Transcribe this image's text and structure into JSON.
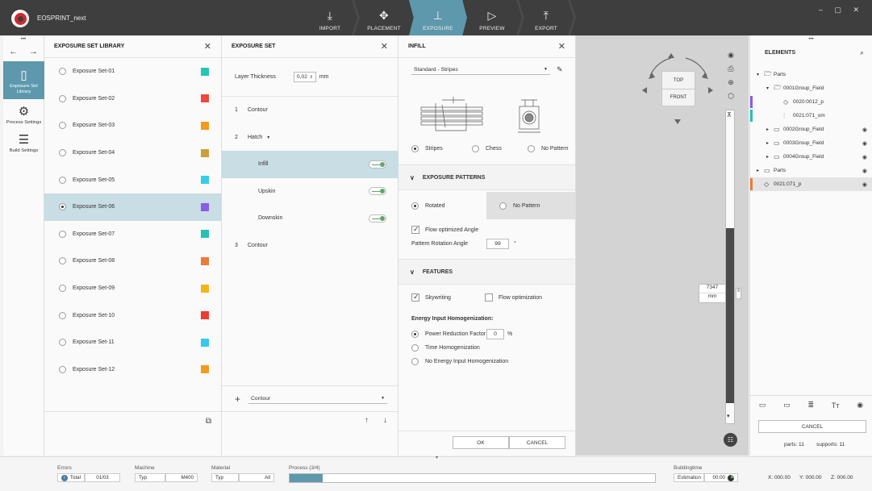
{
  "app": {
    "title": "EOSPRINT_next",
    "window_controls": "– ▢ ✕"
  },
  "nav_tabs": [
    {
      "label": "IMPORT",
      "icon": "download-icon"
    },
    {
      "label": "PLACEMENT",
      "icon": "move-icon"
    },
    {
      "label": "EXPOSURE",
      "icon": "exposure-icon",
      "active": true
    },
    {
      "label": "PREVIEW",
      "icon": "play-icon"
    },
    {
      "label": "EXPORT",
      "icon": "upload-icon"
    }
  ],
  "rail": {
    "dots": "•••",
    "items": [
      {
        "label": "Exposure Set Library",
        "active": true
      },
      {
        "label": "Process Settings"
      },
      {
        "label": "Build Settings"
      }
    ]
  },
  "library": {
    "title": "EXPOSURE SET LIBRARY",
    "sets": [
      {
        "label": "Exposure Set-01",
        "color": "#26c4b4"
      },
      {
        "label": "Exposure Set-02",
        "color": "#f0473e"
      },
      {
        "label": "Exposure Set-03",
        "color": "#f59a1f"
      },
      {
        "label": "Exposure Set-04",
        "color": "#c9a03a"
      },
      {
        "label": "Exposure Set-05",
        "color": "#35cde8"
      },
      {
        "label": "Exposure Set-06",
        "color": "#8a5ce6",
        "selected": true
      },
      {
        "label": "Exposure Set-07",
        "color": "#23c2b5"
      },
      {
        "label": "Exposure Set-08",
        "color": "#ec7b3a"
      },
      {
        "label": "Exposure Set-09",
        "color": "#f2b51a"
      },
      {
        "label": "Exposure Set-10",
        "color": "#ee3b32"
      },
      {
        "label": "Exposure Set-11",
        "color": "#3bc6ee"
      },
      {
        "label": "Exposure Set-12",
        "color": "#f6991f"
      }
    ]
  },
  "exposure_set": {
    "title": "EXPOSURE SET",
    "layer_thickness_label": "Layer Thickness",
    "layer_thickness_value": "0,02",
    "layer_thickness_unit": "mm",
    "rows": [
      {
        "num": "1",
        "label": "Contour"
      },
      {
        "num": "2",
        "label": "Hatch",
        "dropdown": "▾"
      },
      {
        "num": "",
        "label": "Infill",
        "toggle": true,
        "selected": true
      },
      {
        "num": "",
        "label": "Upskin",
        "toggle": true
      },
      {
        "num": "",
        "label": "Downskin",
        "toggle": true
      },
      {
        "num": "3",
        "label": "Contour"
      }
    ],
    "add_select_value": "Contour"
  },
  "infill": {
    "title": "INFILL",
    "strategy": "Standard - Stripes",
    "pattern_options": [
      "Stripes",
      "Chess",
      "No Pattern"
    ],
    "pattern_selected": "Stripes",
    "exposure_patterns": {
      "title": "EXPOSURE PATTERNS",
      "options": [
        "Rotated",
        "No Pattern"
      ],
      "selected": "Rotated",
      "flow_optimized_label": "Flow optimized Angle",
      "rotation_label": "Pattern Rotation Angle",
      "rotation_value": "99",
      "rotation_unit": "°"
    },
    "features": {
      "title": "FEATURES",
      "skywriting_label": "Skywriting",
      "flow_opt_label": "Flow optimization",
      "energy_title": "Energy Input Homogenization:",
      "energy_options": [
        "Power Reduction Factor",
        "Time Homogenization",
        "No Energy Input Homogenization"
      ],
      "power_value": "0",
      "power_unit": "%"
    },
    "ok_label": "OK",
    "cancel_label": "CANCEL"
  },
  "viewport": {
    "cube_top": "TOP",
    "cube_front": "FRONT",
    "ruler_value": "7347",
    "ruler_unit": "mm"
  },
  "elements": {
    "title": "ELEMENTS",
    "tree": [
      {
        "label": "Parts",
        "indent": 0,
        "icon": "folder-open-icon",
        "caret": "▾"
      },
      {
        "label": "0001Group_Field",
        "indent": 1,
        "icon": "folder-open-icon",
        "caret": "▾"
      },
      {
        "label": "0020:0012_p",
        "indent": 2,
        "icon": "diamond-icon",
        "bar": "#8a5ce6"
      },
      {
        "label": "0021:071_om",
        "indent": 2,
        "icon": "chart-icon",
        "bar": "#23c2b5"
      },
      {
        "label": "0002Group_Field",
        "indent": 1,
        "icon": "folder-icon",
        "caret": "▸",
        "eye": true
      },
      {
        "label": "0003Group_Field",
        "indent": 1,
        "icon": "folder-icon",
        "caret": "▸",
        "eye": true
      },
      {
        "label": "0004Group_Field",
        "indent": 1,
        "icon": "folder-icon",
        "caret": "▸",
        "eye": true
      },
      {
        "label": "Parts",
        "indent": 0,
        "icon": "folder-icon",
        "caret": "▸",
        "eye": true
      },
      {
        "label": "0021:071_p",
        "indent": 0,
        "icon": "diamond-icon",
        "bar": "#ec7b3a",
        "eye": true,
        "selected": true
      }
    ],
    "cancel_label": "CANCEL",
    "parts_count": "parts: 11",
    "supports_count": "supports: 11"
  },
  "status": {
    "errors_label": "Errors",
    "total_label": "Total",
    "total_value": "01/03",
    "machine_label": "Machine",
    "machine_typ": "Typ",
    "machine_value": "M400",
    "material_label": "Material",
    "material_typ": "Typ",
    "material_value": "All",
    "process_label": "Process (3/4)",
    "process_fraction": 0.09,
    "buildingtime_label": "Buildingtime",
    "estimation_label": "Estimation",
    "estimation_value": "00:00",
    "coord_x": "X: 000.00",
    "coord_y": "Y: 000.00",
    "coord_z": "Z: 000.00"
  }
}
